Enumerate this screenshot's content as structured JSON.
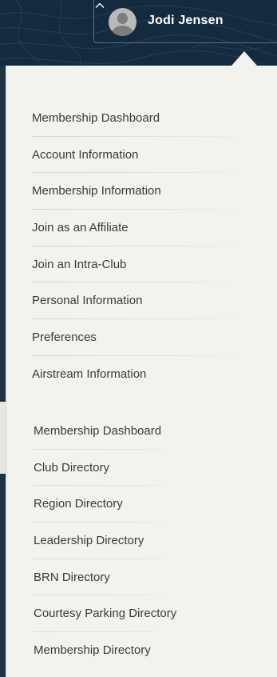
{
  "header": {
    "user_name": "Jodi Jensen",
    "avatar_icon": "user-avatar-icon",
    "toggle_icon": "chevron-up-icon",
    "background_color": "#142b3d"
  },
  "menu_primary": {
    "items": [
      {
        "label": "Membership Dashboard"
      },
      {
        "label": "Account Information"
      },
      {
        "label": "Membership Information"
      },
      {
        "label": "Join as an Affiliate"
      },
      {
        "label": "Join an Intra-Club"
      },
      {
        "label": "Personal Information"
      },
      {
        "label": "Preferences"
      },
      {
        "label": "Airstream Information"
      }
    ]
  },
  "menu_directories": {
    "items": [
      {
        "label": "Membership Dashboard"
      },
      {
        "label": "Club Directory"
      },
      {
        "label": "Region Directory"
      },
      {
        "label": "Leadership Directory"
      },
      {
        "label": "BRN Directory"
      },
      {
        "label": "Courtesy Parking Directory"
      },
      {
        "label": "Membership Directory"
      }
    ]
  }
}
